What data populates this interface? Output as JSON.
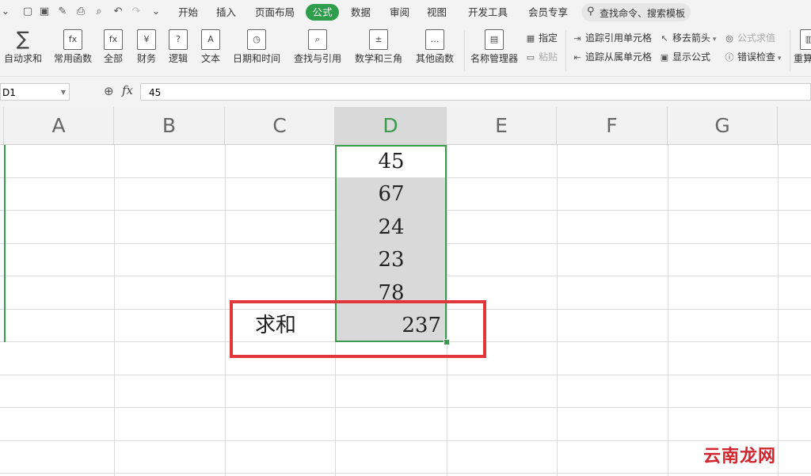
{
  "menu": {
    "items": [
      "开始",
      "插入",
      "页面布局",
      "公式",
      "数据",
      "审阅",
      "视图",
      "开发工具",
      "会员专享"
    ],
    "active": "公式",
    "search_placeholder": "查找命令、搜索模板"
  },
  "ribbon": {
    "auto_sum": "自动求和",
    "common_func": "常用函数",
    "all": "全部",
    "finance": "财务",
    "logic": "逻辑",
    "text": "文本",
    "datetime": "日期和时间",
    "lookup": "查找与引用",
    "math": "数学和三角",
    "other": "其他函数",
    "name_manager": "名称管理器",
    "assign": "指定",
    "paste": "粘贴",
    "trace_precedents": "追踪引用单元格",
    "trace_dependents": "追踪从属单元格",
    "remove_arrows": "移去箭头",
    "show_formulas": "显示公式",
    "eval_formula": "公式求值",
    "error_check": "错误检查",
    "recalc": "重算"
  },
  "formula_bar": {
    "name_box": "D1",
    "fx": "fx",
    "content": "45"
  },
  "columns": [
    "A",
    "B",
    "C",
    "D",
    "E",
    "F",
    "G"
  ],
  "selected_column": "D",
  "cells": {
    "D": [
      "45",
      "67",
      "24",
      "23",
      "78"
    ],
    "sum_label": "求和",
    "sum_value": "237"
  },
  "watermark": "云南龙网",
  "colors": {
    "accent": "#2e9d4c",
    "highlight_box": "#e0363c"
  }
}
